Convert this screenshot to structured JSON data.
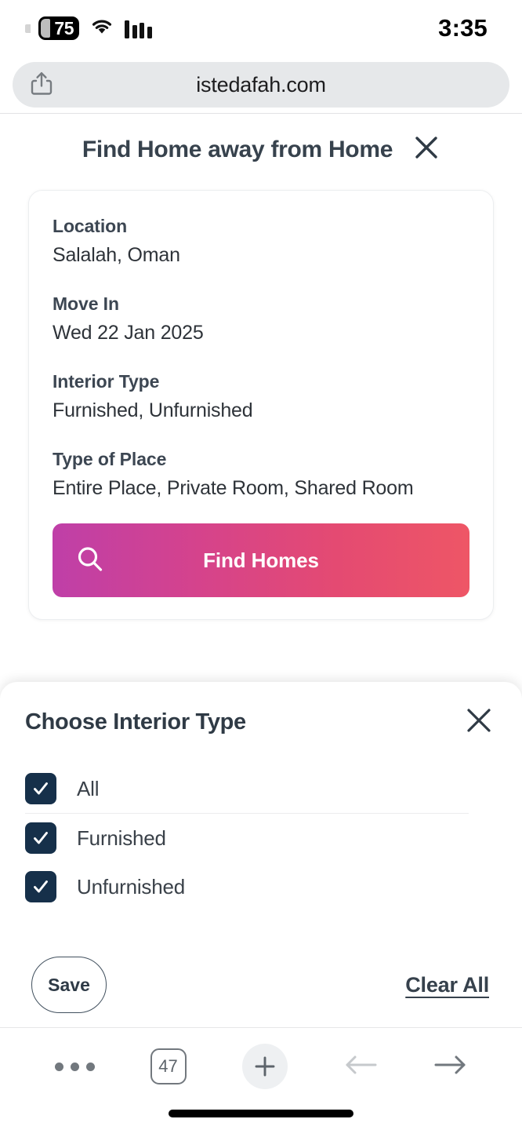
{
  "status_bar": {
    "battery_level": "75",
    "time": "3:35",
    "wifi_icon": "wifi-icon",
    "signal_icon": "signal-bars-icon"
  },
  "browser": {
    "url": "istedafah.com",
    "share_icon": "share-icon",
    "toolbar": {
      "more_label": "more-options",
      "tab_count": "47",
      "new_tab_label": "new-tab",
      "back_label": "back",
      "forward_label": "forward",
      "back_enabled": "false",
      "forward_enabled": "true"
    }
  },
  "page": {
    "title": "Find Home away from Home",
    "close_icon": "close-icon",
    "fields": [
      {
        "label": "Location",
        "value": "Salalah, Oman"
      },
      {
        "label": "Move In",
        "value": "Wed 22 Jan 2025"
      },
      {
        "label": "Interior Type",
        "value": "Furnished, Unfurnished"
      },
      {
        "label": "Type of Place",
        "value": "Entire Place, Private Room, Shared Room"
      }
    ],
    "find_button": {
      "label": "Find Homes",
      "icon": "search-icon",
      "gradient_start": "#bf3fa8",
      "gradient_end": "#ee5666"
    }
  },
  "sheet": {
    "title": "Choose Interior Type",
    "close_icon": "close-icon",
    "checkbox_color": "#16304a",
    "options": [
      {
        "label": "All",
        "checked": true
      },
      {
        "label": "Furnished",
        "checked": true
      },
      {
        "label": "Unfurnished",
        "checked": true
      }
    ],
    "save_label": "Save",
    "clear_label": "Clear All"
  }
}
